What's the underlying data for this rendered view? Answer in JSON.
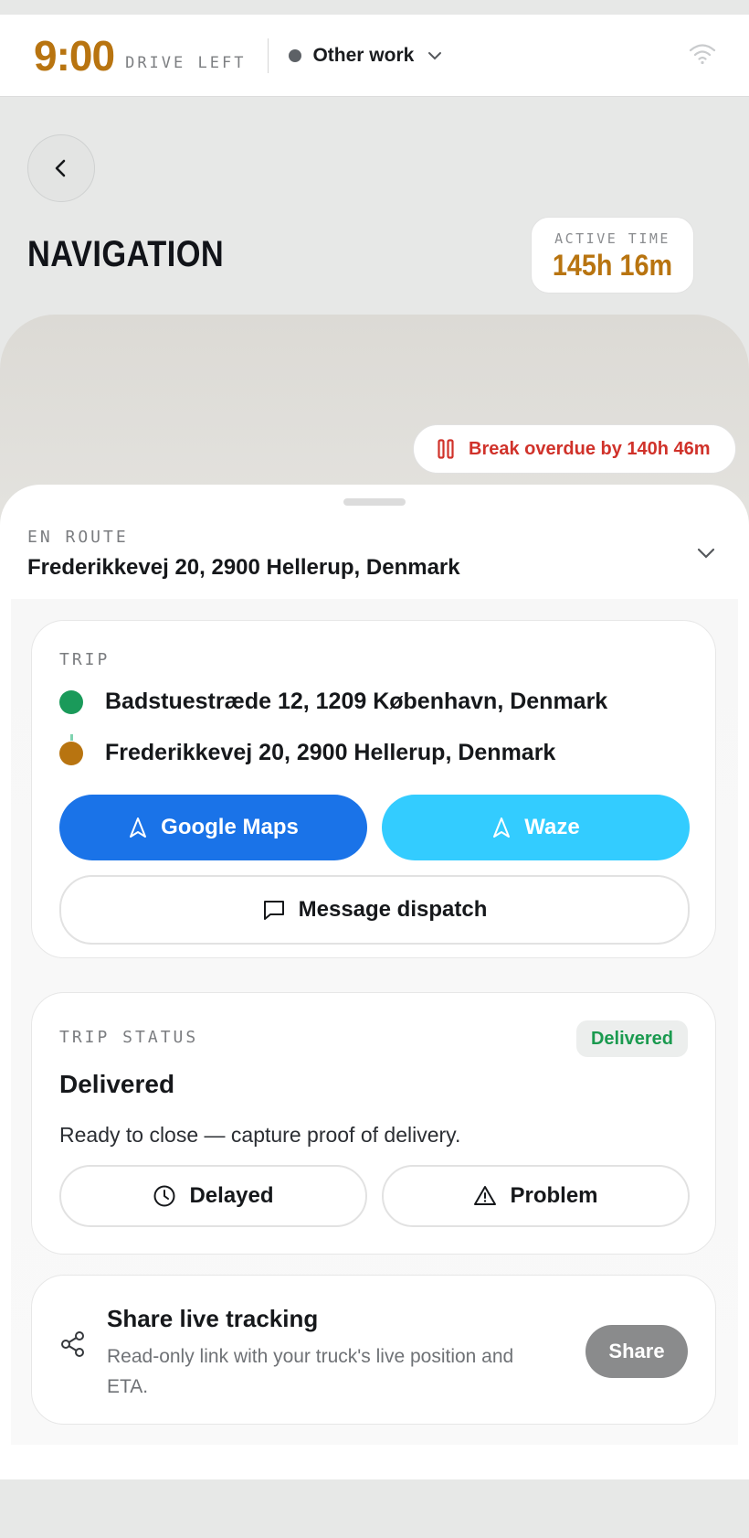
{
  "topbar": {
    "drive_time": "9:00",
    "drive_left_label": "DRIVE LEFT",
    "status_label": "Other work"
  },
  "header": {
    "title": "NAVIGATION",
    "active_time_label": "ACTIVE TIME",
    "active_time_value": "145h 16m"
  },
  "map": {
    "break_alert": "Break overdue by 140h 46m"
  },
  "sheet": {
    "en_route_label": "EN ROUTE",
    "destination": "Frederikkevej 20, 2900 Hellerup, Denmark"
  },
  "trip": {
    "label": "TRIP",
    "origin": "Badstuestræde 12, 1209 København, Denmark",
    "destination": "Frederikkevej 20, 2900 Hellerup, Denmark",
    "google_maps_label": "Google Maps",
    "waze_label": "Waze",
    "message_label": "Message dispatch"
  },
  "trip_status": {
    "label": "TRIP STATUS",
    "badge": "Delivered",
    "title": "Delivered",
    "description": "Ready to close — capture proof of delivery.",
    "delayed_label": "Delayed",
    "problem_label": "Problem"
  },
  "share": {
    "title": "Share live tracking",
    "description": "Read-only link with your truck's live position and ETA.",
    "button_label": "Share"
  },
  "colors": {
    "accent_amber": "#b87410",
    "alert_red": "#d0322a",
    "google_blue": "#1a73e8",
    "waze_cyan": "#33ccff",
    "success_green": "#1a9a4f",
    "origin_dot": "#1a9a5a",
    "destination_dot": "#b87410"
  }
}
